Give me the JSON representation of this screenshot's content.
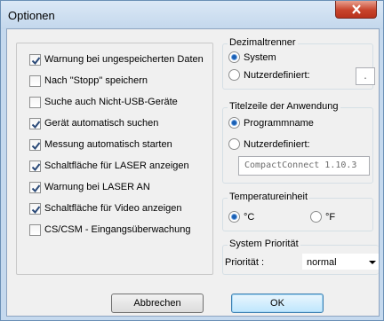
{
  "window": {
    "title": "Optionen"
  },
  "options": [
    {
      "label": "Warnung bei ungespeicherten Daten",
      "checked": true
    },
    {
      "label": "Nach \"Stopp\" speichern",
      "checked": false
    },
    {
      "label": "Suche auch Nicht-USB-Geräte",
      "checked": false
    },
    {
      "label": "Gerät automatisch suchen",
      "checked": true
    },
    {
      "label": "Messung automatisch starten",
      "checked": true
    },
    {
      "label": "Schaltfläche für LASER anzeigen",
      "checked": true
    },
    {
      "label": "Warnung bei LASER AN",
      "checked": true
    },
    {
      "label": "Schaltfläche für Video anzeigen",
      "checked": true
    },
    {
      "label": "CS/CSM - Eingangsüberwachung",
      "checked": false
    }
  ],
  "decimal": {
    "title": "Dezimaltrenner",
    "system_label": "System",
    "custom_label": "Nutzerdefiniert:",
    "custom_value": ".",
    "selected": "system"
  },
  "titlebar_group": {
    "title": "Titelzeile der Anwendung",
    "program_label": "Programmname",
    "custom_label": "Nutzerdefiniert:",
    "custom_value": "CompactConnect 1.10.3",
    "selected": "program"
  },
  "temperature": {
    "title": "Temperatureinheit",
    "celsius_label": "°C",
    "fahrenheit_label": "°F",
    "selected": "celsius"
  },
  "priority": {
    "title": "System Priorität",
    "label": "Priorität :",
    "value": "normal"
  },
  "buttons": {
    "cancel": "Abbrechen",
    "ok": "OK"
  }
}
